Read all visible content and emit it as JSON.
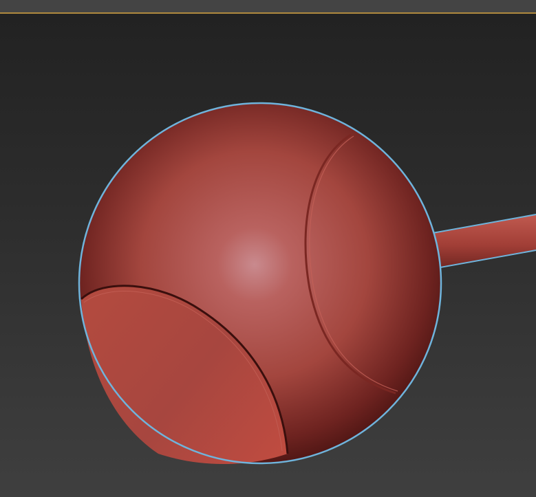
{
  "viewport": {
    "active_border_color": "#b08a3e",
    "background_top": "#222222",
    "background_bottom": "#3f3f3f"
  },
  "object": {
    "type": "sphere-shade-with-rod",
    "base_color": "#b4463c",
    "highlight_color": "#c8868a",
    "shadow_color": "#4a1412",
    "selection_outline_color": "#6fb4dc",
    "selected": true
  }
}
